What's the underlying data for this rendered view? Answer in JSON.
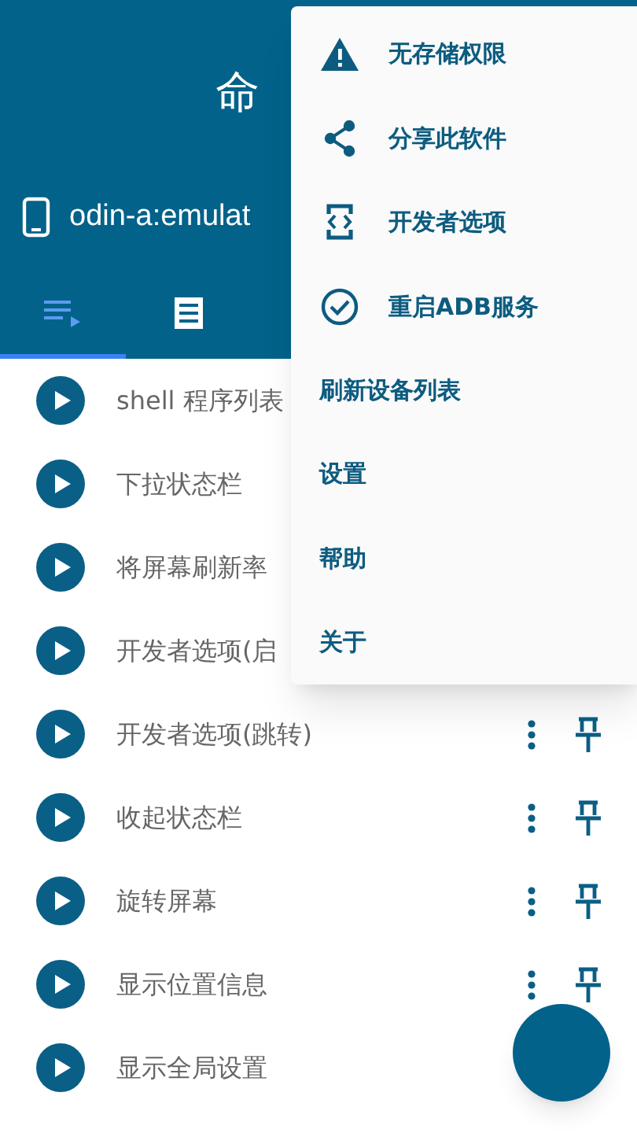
{
  "header": {
    "title": "命",
    "device": "odin-a:emulat"
  },
  "tabs": [
    {
      "kind": "list",
      "selected": true
    },
    {
      "kind": "receipt",
      "selected": false
    }
  ],
  "commands": [
    {
      "label": "shell 程序列表"
    },
    {
      "label": "下拉状态栏"
    },
    {
      "label": "将屏幕刷新率"
    },
    {
      "label": "开发者选项(启"
    },
    {
      "label": "开发者选项(跳转)",
      "show_actions": true
    },
    {
      "label": "收起状态栏",
      "show_actions": true
    },
    {
      "label": "旋转屏幕",
      "show_actions": true
    },
    {
      "label": "显示位置信息",
      "show_actions": true
    },
    {
      "label": "显示全局设置"
    }
  ],
  "menu": [
    {
      "label": "无存储权限",
      "kind": "warning"
    },
    {
      "label": "分享此软件",
      "kind": "share"
    },
    {
      "label": "开发者选项",
      "kind": "developer"
    },
    {
      "label": "重启ADB服务",
      "kind": "check"
    },
    {
      "label": "刷新设备列表",
      "kind": "plain"
    },
    {
      "label": "设置",
      "kind": "plain"
    },
    {
      "label": "帮助",
      "kind": "plain"
    },
    {
      "label": "关于",
      "kind": "plain"
    }
  ]
}
